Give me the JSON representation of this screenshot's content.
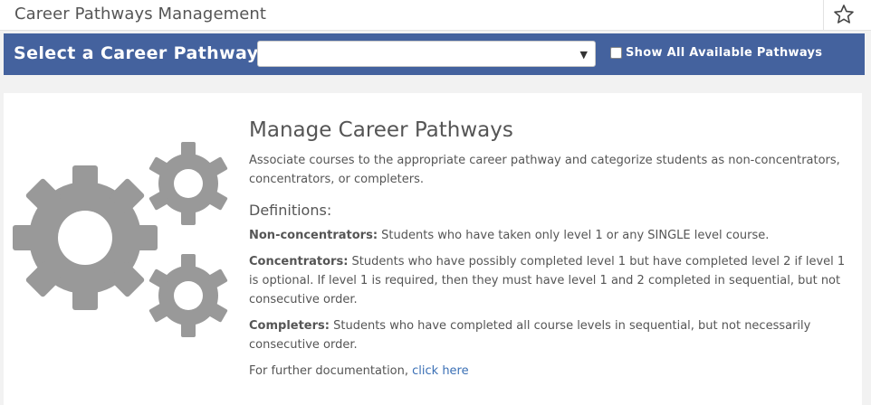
{
  "header": {
    "title": "Career Pathways Management",
    "favorite_icon": "star-outline-icon"
  },
  "toolbar": {
    "select_label": "Select a Career Pathway:",
    "select_value": "",
    "show_all_label": "Show All Available Pathways",
    "show_all_checked": false,
    "accent_color": "#44629e"
  },
  "main": {
    "illustration_icon": "gears-icon",
    "heading": "Manage Career Pathways",
    "description": "Associate courses to the appropriate career pathway and categorize students as non-concentrators, concentrators, or completers.",
    "definitions_heading": "Definitions:",
    "definitions": [
      {
        "term": "Non-concentrators:",
        "text": " Students who have taken only level 1 or any SINGLE level course."
      },
      {
        "term": "Concentrators:",
        "text": " Students who have possibly completed level 1 but have completed level 2 if level 1 is optional. If level 1 is required, then they must have level 1 and 2 completed in sequential, but not consecutive order."
      },
      {
        "term": "Completers:",
        "text": " Students who have completed all course levels in sequential, but not necessarily consecutive order."
      }
    ],
    "doc_prefix": "For further documentation, ",
    "doc_link": "click here",
    "link_color": "#3a6fb5"
  }
}
